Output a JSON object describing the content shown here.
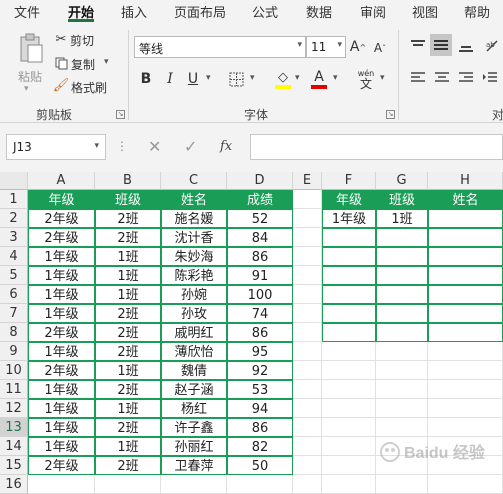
{
  "menu": {
    "tabs": [
      "文件",
      "开始",
      "插入",
      "页面布局",
      "公式",
      "数据",
      "审阅",
      "视图",
      "帮助"
    ]
  },
  "ribbon": {
    "clipboard": {
      "paste": "粘贴",
      "cut": "剪切",
      "copy": "复制",
      "format_painter": "格式刷",
      "label": "剪贴板"
    },
    "font": {
      "font_name": "等线",
      "font_size": "11",
      "bold": "B",
      "italic": "I",
      "underline": "U",
      "font_label": "字体",
      "phonetic": "wén",
      "increase": "A",
      "decrease": "A"
    },
    "align_label": "对"
  },
  "formula_bar": {
    "name_box": "J13",
    "fx": "fx",
    "cancel": "✕",
    "enter": "✓",
    "value": ""
  },
  "columns": [
    "A",
    "B",
    "C",
    "D",
    "E",
    "F",
    "G",
    "H"
  ],
  "rows": [
    "1",
    "2",
    "3",
    "4",
    "5",
    "6",
    "7",
    "8",
    "9",
    "10",
    "11",
    "12",
    "13",
    "14",
    "15",
    "16"
  ],
  "table": {
    "header": [
      "年级",
      "班级",
      "姓名",
      "成绩"
    ],
    "rows": [
      [
        "2年级",
        "2班",
        "施名媛",
        "52"
      ],
      [
        "2年级",
        "2班",
        "沈计香",
        "84"
      ],
      [
        "1年级",
        "1班",
        "朱妙海",
        "86"
      ],
      [
        "1年级",
        "1班",
        "陈彩艳",
        "91"
      ],
      [
        "1年级",
        "1班",
        "孙婉",
        "100"
      ],
      [
        "1年级",
        "2班",
        "孙玫",
        "74"
      ],
      [
        "2年级",
        "2班",
        "戚明红",
        "86"
      ],
      [
        "1年级",
        "2班",
        "薄欣怡",
        "95"
      ],
      [
        "2年级",
        "1班",
        "魏倩",
        "92"
      ],
      [
        "1年级",
        "2班",
        "赵子涵",
        "53"
      ],
      [
        "1年级",
        "1班",
        "杨红",
        "94"
      ],
      [
        "1年级",
        "2班",
        "许子鑫",
        "86"
      ],
      [
        "1年级",
        "1班",
        "孙丽红",
        "82"
      ],
      [
        "2年级",
        "2班",
        "卫春萍",
        "50"
      ]
    ]
  },
  "criteria": {
    "header": [
      "年级",
      "班级",
      "姓名"
    ],
    "values": [
      "1年级",
      "1班",
      ""
    ]
  },
  "watermark": "Baidu 经验",
  "colors": {
    "accent": "#217346",
    "table_header": "#1a9e57"
  }
}
